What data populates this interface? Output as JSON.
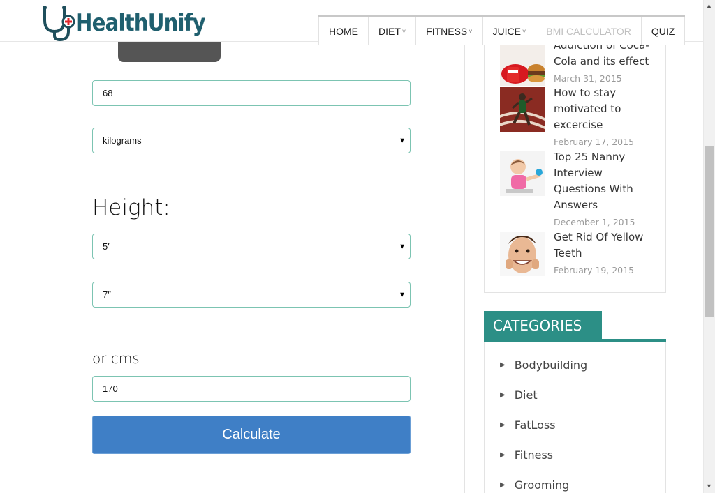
{
  "header": {
    "logo": "HealthUnify",
    "nav": [
      {
        "label": "HOME",
        "dropdown": false
      },
      {
        "label": "DIET",
        "dropdown": true
      },
      {
        "label": "FITNESS",
        "dropdown": true
      },
      {
        "label": "JUICE",
        "dropdown": true
      },
      {
        "label": "BMI CALCULATOR",
        "dropdown": false,
        "active": true
      },
      {
        "label": "QUIZ",
        "dropdown": false
      }
    ]
  },
  "form": {
    "weight_value": "68",
    "weight_unit": "kilograms",
    "height_label": "Height:",
    "height_feet": "5′",
    "height_inches": "7″",
    "cms_label": "or cms",
    "cms_value": "170",
    "calculate_label": "Calculate"
  },
  "sidebar": {
    "posts": [
      {
        "title": "Addiction of Coca-Cola and its effect",
        "date": "March 31, 2015",
        "thumb": "coca-cola-thumb"
      },
      {
        "title": "How to stay motivated to excercise",
        "date": "February 17, 2015",
        "thumb": "runner-thumb"
      },
      {
        "title": "Top 25 Nanny Interview Questions With Answers",
        "date": "December 1, 2015",
        "thumb": "child-thumb"
      },
      {
        "title": "Get Rid Of Yellow Teeth",
        "date": "February 19, 2015",
        "thumb": "teeth-thumb"
      }
    ],
    "categories_title": "CATEGORIES",
    "categories": [
      "Bodybuilding",
      "Diet",
      "FatLoss",
      "Fitness",
      "Grooming"
    ]
  },
  "colors": {
    "accent": "#2c8f86",
    "button": "#3f7fc6",
    "field_border": "#7cc4b2"
  }
}
